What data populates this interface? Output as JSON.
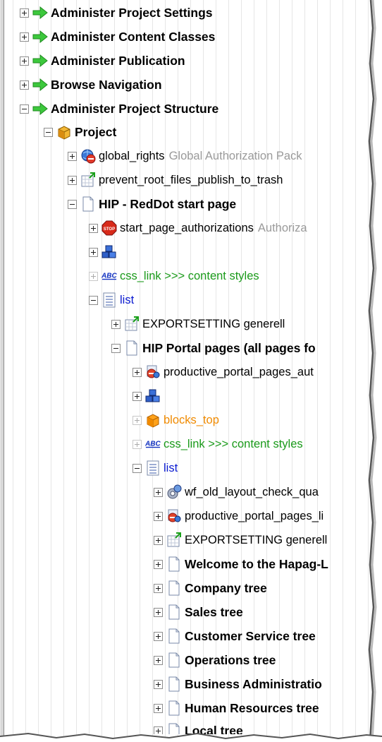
{
  "tree": {
    "rows": [
      {
        "label": "Administer Project Settings"
      },
      {
        "label": "Administer Content Classes"
      },
      {
        "label": "Administer Publication"
      },
      {
        "label": "Browse Navigation"
      },
      {
        "label": "Administer Project Structure"
      },
      {
        "label": "Project"
      },
      {
        "label": "global_rights",
        "desc": "Global Authorization Pack"
      },
      {
        "label": "prevent_root_files_publish_to_trash"
      },
      {
        "label": "HIP - RedDot start page"
      },
      {
        "label": "start_page_authorizations",
        "desc": "Authoriza"
      },
      {
        "label": ""
      },
      {
        "label": "css_link >>> content styles"
      },
      {
        "label": "list"
      },
      {
        "label": "EXPORTSETTING generell"
      },
      {
        "label": "HIP Portal pages (all pages fo"
      },
      {
        "label": "productive_portal_pages_aut"
      },
      {
        "label": ""
      },
      {
        "label": "blocks_top"
      },
      {
        "label": "css_link >>> content styles"
      },
      {
        "label": "list"
      },
      {
        "label": "wf_old_layout_check_qua"
      },
      {
        "label": "productive_portal_pages_li"
      },
      {
        "label": "EXPORTSETTING generell"
      },
      {
        "label": "Welcome to the Hapag-L"
      },
      {
        "label": "Company tree"
      },
      {
        "label": "Sales tree"
      },
      {
        "label": "Customer Service tree"
      },
      {
        "label": "Operations tree"
      },
      {
        "label": "Business Administratio"
      },
      {
        "label": "Human Resources tree"
      },
      {
        "label": "Local tree"
      }
    ]
  },
  "colors": {
    "green_text": "#1a9a1a",
    "blue_text": "#0a1ad0",
    "orange_text": "#f08a00",
    "gray_text": "#9a9a9a",
    "arrow_green": "#3cc83c"
  },
  "icons": [
    "expand-toggle-icon",
    "collapse-toggle-icon",
    "green-arrow-icon",
    "package-icon",
    "globe-stop-icon",
    "table-export-icon",
    "page-icon",
    "stop-sign-icon",
    "blue-cubes-icon",
    "abc-text-icon",
    "list-icon",
    "orange-box-icon",
    "gear-globe-icon",
    "search-stop-icon"
  ]
}
